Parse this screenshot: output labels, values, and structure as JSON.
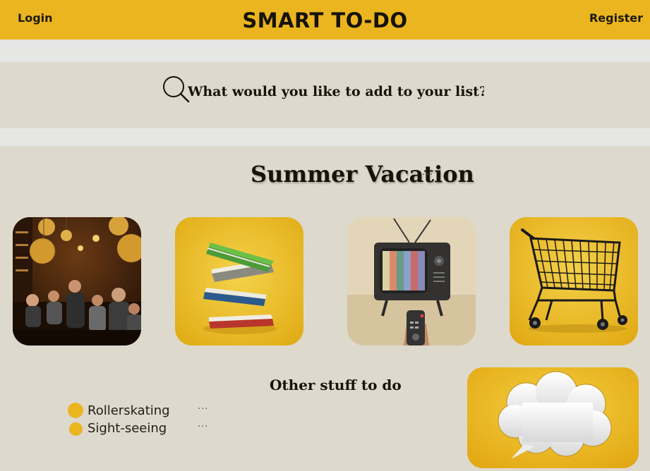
{
  "header": {
    "login_label": "Login",
    "title": "SMART TO-DO",
    "register_label": "Register"
  },
  "search": {
    "placeholder": "What would you like to add to your list?",
    "icon": "search-icon"
  },
  "list": {
    "title": "Summer Vacation",
    "menu": "···",
    "categories": [
      {
        "name": "restaurant",
        "icon": "restaurant-image"
      },
      {
        "name": "books",
        "icon": "books-image"
      },
      {
        "name": "tv",
        "icon": "tv-image"
      },
      {
        "name": "shopping",
        "icon": "shopping-cart-image"
      }
    ]
  },
  "other": {
    "title": "Other stuff to do",
    "items": [
      {
        "label": "Rollerskating",
        "menu": "···"
      },
      {
        "label": "Sight-seeing",
        "menu": "···"
      }
    ]
  },
  "colors": {
    "accent": "#ebb520",
    "background": "#ddd9cc",
    "stripe": "#e6e6e4",
    "text": "#17130a"
  }
}
